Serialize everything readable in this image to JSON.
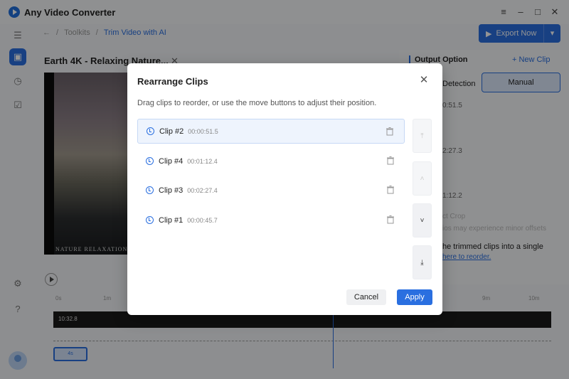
{
  "app": {
    "title": "Any Video Converter",
    "window_controls": [
      "≡",
      "–",
      "□",
      "✕"
    ]
  },
  "breadcrumb": {
    "root": "Toolkits",
    "current": "Trim Video with AI"
  },
  "export": {
    "label": "Export Now"
  },
  "video": {
    "title": "Earth 4K - Relaxing Nature...",
    "caption": "NATURE RELAXATION MU",
    "current_time": "10:32.8"
  },
  "panel": {
    "title": "Output Option",
    "new_clip": "+ New Clip",
    "tab_detection": "Detection",
    "tab_manual": "Manual",
    "fragment_1": "0:51.5",
    "fragment_2": "2:27.3",
    "fragment_3": "1:12.2",
    "fragment_4": "ct Crop",
    "fragment_5": "ios may experience minor offsets",
    "fragment_6": "he trimmed clips into a single",
    "fragment_link": "here to reorder."
  },
  "timeline": {
    "ticks": [
      "0s",
      "1m",
      "9m",
      "10m"
    ],
    "segment_label": "4s"
  },
  "dialog": {
    "title": "Rearrange Clips",
    "description": "Drag clips to reorder, or use the move buttons to adjust their position.",
    "clips": [
      {
        "name": "Clip #2",
        "duration": "00:00:51.5"
      },
      {
        "name": "Clip #4",
        "duration": "00:01:12.4"
      },
      {
        "name": "Clip #3",
        "duration": "00:02:27.4"
      },
      {
        "name": "Clip #1",
        "duration": "00:00:45.7"
      }
    ],
    "cancel": "Cancel",
    "apply": "Apply"
  }
}
